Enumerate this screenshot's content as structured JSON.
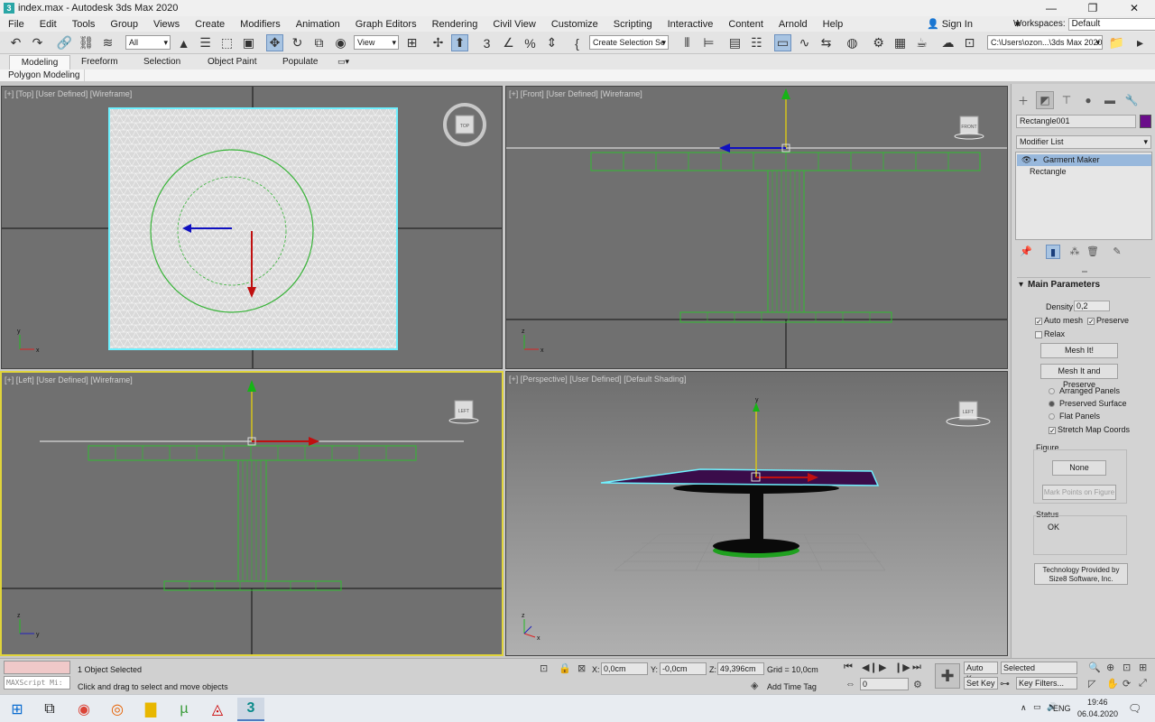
{
  "window": {
    "title": "index.max - Autodesk 3ds Max 2020",
    "app_icon": "3"
  },
  "menubar": {
    "items": [
      "File",
      "Edit",
      "Tools",
      "Group",
      "Views",
      "Create",
      "Modifiers",
      "Animation",
      "Graph Editors",
      "Rendering",
      "Civil View",
      "Customize",
      "Scripting",
      "Interactive",
      "Content",
      "Arnold",
      "Help"
    ],
    "sign_in": "Sign In",
    "workspaces_label": "Workspaces:",
    "workspaces_value": "Default"
  },
  "toolbar": {
    "selection_filter": "All",
    "ref_coord": "View",
    "named_selection": "Create Selection Se",
    "project_path": "C:\\Users\\ozon...\\3ds Max 2020"
  },
  "ribbon": {
    "tabs": [
      "Modeling",
      "Freeform",
      "Selection",
      "Object Paint",
      "Populate"
    ],
    "active_tab": "Modeling",
    "subtab": "Polygon Modeling"
  },
  "viewports": {
    "top_left": {
      "label": "[+] [Top] [User Defined] [Wireframe]",
      "cube": "TOP"
    },
    "top_right": {
      "label": "[+] [Front] [User Defined] [Wireframe]",
      "cube": "FRONT"
    },
    "bottom_left": {
      "label": "[+] [Left] [User Defined] [Wireframe]",
      "cube": "LEFT"
    },
    "bottom_right": {
      "label": "[+] [Perspective] [User Defined] [Default Shading]",
      "cube": "LEFT"
    }
  },
  "command_panel": {
    "object_name": "Rectangle001",
    "object_color": "#6a0d8a",
    "modifier_list": "Modifier List",
    "stack": [
      "Garment Maker",
      "Rectangle"
    ],
    "rollout": "Main Parameters",
    "density_label": "Density",
    "density_value": "0,2",
    "auto_mesh": "Auto mesh",
    "preserve": "Preserve",
    "relax": "Relax",
    "mesh_it": "Mesh It!",
    "mesh_it_preserve": "Mesh It and Preserve",
    "arranged_panels": "Arranged Panels",
    "preserved_surface": "Preserved Surface",
    "flat_panels": "Flat Panels",
    "stretch_map": "Stretch Map Coords",
    "figure_label": "Figure",
    "none_button": "None",
    "mark_points": "Mark Points on Figure",
    "status_label": "Status",
    "status_value": "OK",
    "tech_line1": "Technology Provided by",
    "tech_line2": "Size8 Software, Inc."
  },
  "statusbar": {
    "maxscript": "MAXScript Mi:",
    "selected": "1 Object Selected",
    "prompt": "Click and drag to select and move objects",
    "x_label": "X:",
    "x_value": "0,0cm",
    "y_label": "Y:",
    "y_value": "-0,0cm",
    "z_label": "Z:",
    "z_value": "49,396cm",
    "grid": "Grid = 10,0cm",
    "add_time_tag": "Add Time Tag",
    "frame": "0",
    "auto_key": "Auto Key",
    "set_key": "Set Key",
    "key_mode": "Selected",
    "key_filters": "Key Filters..."
  },
  "taskbar": {
    "lang": "ENG",
    "time": "19:46",
    "date": "06.04.2020"
  }
}
